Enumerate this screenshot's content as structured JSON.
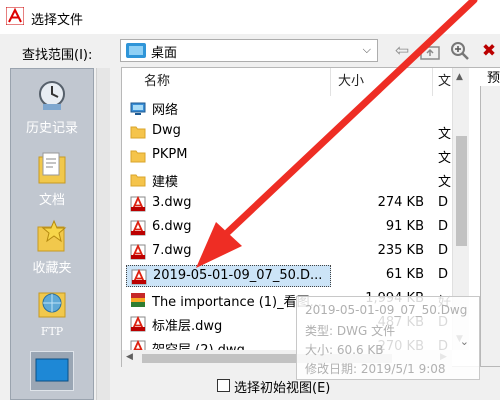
{
  "window": {
    "title": "选择文件"
  },
  "lookin": {
    "label": "查找范围(I):",
    "value": "桌面"
  },
  "preview": {
    "label": "预"
  },
  "places": [
    "历史记录",
    "文档",
    "收藏夹",
    "FTP"
  ],
  "columns": {
    "name": "名称",
    "size": "大小",
    "type": "文"
  },
  "files": [
    {
      "name": "网络",
      "size": "",
      "type": "",
      "icon": "network-icon"
    },
    {
      "name": "Dwg",
      "size": "",
      "type": "文",
      "icon": "folder-icon"
    },
    {
      "name": "PKPM",
      "size": "",
      "type": "文",
      "icon": "folder-icon"
    },
    {
      "name": "建模",
      "size": "",
      "type": "文",
      "icon": "folder-icon"
    },
    {
      "name": "3.dwg",
      "size": "274 KB",
      "type": "D",
      "icon": "dwg-file-icon"
    },
    {
      "name": "6.dwg",
      "size": "91 KB",
      "type": "D",
      "icon": "dwg-file-icon"
    },
    {
      "name": "7.dwg",
      "size": "235 KB",
      "type": "D",
      "icon": "dwg-file-icon"
    },
    {
      "name": "2019-05-01-09_07_50.D...",
      "size": "61 KB",
      "type": "D",
      "icon": "dwg-file-icon",
      "selected": true
    },
    {
      "name": "The importance (1)_看图...",
      "size": "1,994 KB",
      "type": "好",
      "icon": "book-file-icon"
    },
    {
      "name": "标准层.dwg",
      "size": "487 KB",
      "type": "D",
      "icon": "dwg-file-icon"
    },
    {
      "name": "架空层 (2).dwg",
      "size": "270 KB",
      "type": "D",
      "icon": "dwg-file-icon"
    }
  ],
  "tooltip": {
    "line1": "2019-05-01-09_07_50.Dwg",
    "line2": "类型: DWG 文件",
    "line3": "大小: 60.6 KB",
    "line4": "修改日期: 2019/5/1 9:08"
  },
  "checkbox": {
    "label": "选择初始视图(E)",
    "checked": false
  },
  "colors": {
    "selection": "#cce4f7",
    "arrow": "#ee2d24",
    "folder": "#f5c44b",
    "places_bg": "#c1c7d0"
  }
}
